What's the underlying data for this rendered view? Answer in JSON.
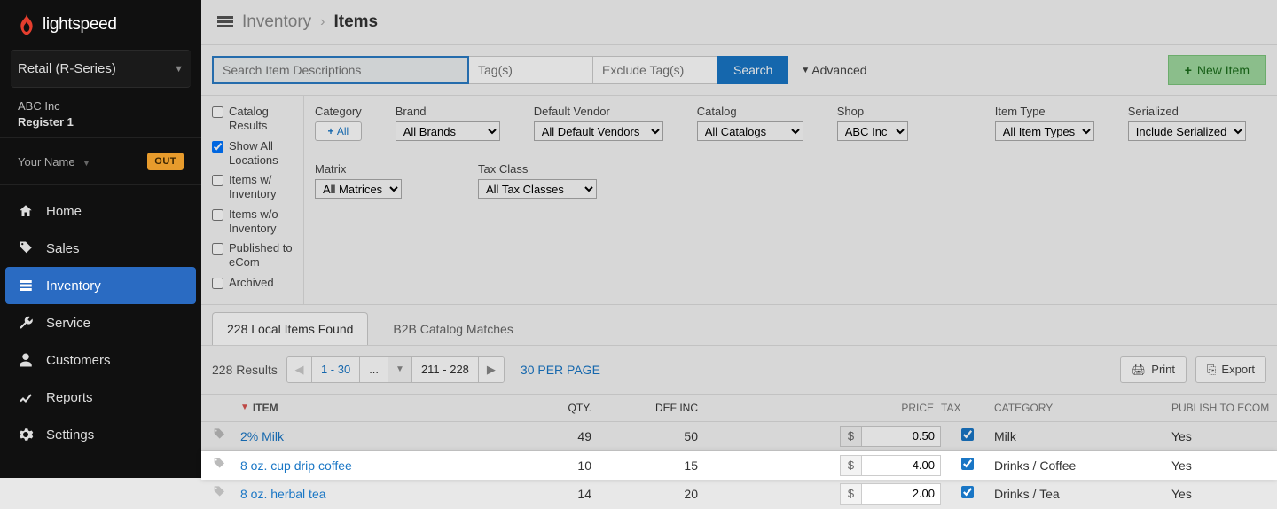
{
  "brand": {
    "name": "lightspeed"
  },
  "series": {
    "label": "Retail (R-Series)"
  },
  "store": {
    "company": "ABC Inc",
    "register": "Register 1"
  },
  "user": {
    "name": "Your Name",
    "out_badge": "OUT"
  },
  "nav": {
    "home": "Home",
    "sales": "Sales",
    "inventory": "Inventory",
    "service": "Service",
    "customers": "Customers",
    "reports": "Reports",
    "settings": "Settings"
  },
  "breadcrumb": {
    "parent": "Inventory",
    "sep": "›",
    "current": "Items"
  },
  "search": {
    "desc_placeholder": "Search Item Descriptions",
    "tags_placeholder": "Tag(s)",
    "excl_tags_placeholder": "Exclude Tag(s)",
    "button": "Search",
    "advanced": "Advanced",
    "new_item": "New Item"
  },
  "checks": {
    "catalog_results": "Catalog Results",
    "show_all_locations": "Show All Locations",
    "items_with_inv": "Items w/ Inventory",
    "items_wo_inv": "Items w/o Inventory",
    "published_ecom": "Published to eCom",
    "archived": "Archived"
  },
  "filters": {
    "category_label": "Category",
    "category_all": "All",
    "brand_label": "Brand",
    "brand_value": "All Brands",
    "vendor_label": "Default Vendor",
    "vendor_value": "All Default Vendors",
    "catalog_label": "Catalog",
    "catalog_value": "All Catalogs",
    "shop_label": "Shop",
    "shop_value": "ABC Inc",
    "item_type_label": "Item Type",
    "item_type_value": "All Item Types",
    "serialized_label": "Serialized",
    "serialized_value": "Include Serialized",
    "matrix_label": "Matrix",
    "matrix_value": "All Matrices",
    "tax_class_label": "Tax Class",
    "tax_class_value": "All Tax Classes"
  },
  "tabs": {
    "local": "228 Local Items Found",
    "b2b": "B2B Catalog Matches"
  },
  "results": {
    "count": "228 Results",
    "range_active": "1 - 30",
    "ellipsis": "...",
    "range_last": "211 - 228",
    "per_page": "30 PER PAGE",
    "print": "Print",
    "export": "Export"
  },
  "table": {
    "headers": {
      "item": "ITEM",
      "qty": "QTY.",
      "definc": "DEF INC",
      "price": "PRICE",
      "tax": "TAX",
      "category": "CATEGORY",
      "publish": "PUBLISH TO ECOM"
    },
    "currency": "$",
    "rows": [
      {
        "name": "2% Milk",
        "qty": "49",
        "definc": "50",
        "price": "0.50",
        "tax": true,
        "category": "Milk",
        "publish": "Yes",
        "highlight": false
      },
      {
        "name": "8 oz. cup drip coffee",
        "qty": "10",
        "definc": "15",
        "price": "4.00",
        "tax": true,
        "category": "Drinks / Coffee",
        "publish": "Yes",
        "highlight": true
      },
      {
        "name": "8 oz. herbal tea",
        "qty": "14",
        "definc": "20",
        "price": "2.00",
        "tax": true,
        "category": "Drinks / Tea",
        "publish": "Yes",
        "highlight": false
      }
    ]
  }
}
